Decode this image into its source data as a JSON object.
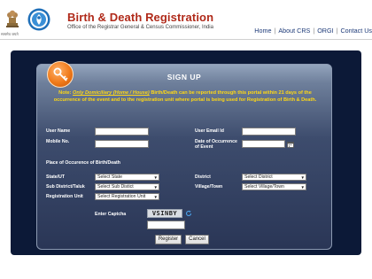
{
  "header": {
    "emblem_caption": "सत्यमेव जयते",
    "title": "Birth & Death Registration",
    "subtitle": "Office of the Registrar General & Census Commissioner, India",
    "nav": [
      "Home",
      "About CRS",
      "ORGI",
      "Contact Us"
    ]
  },
  "form": {
    "title": "SIGN UP",
    "note_prefix": "Note: ",
    "note_emph": "Only Domiciliary (Home / House)",
    "note_rest": " Birth/Death can be reported through this portal within 21 days of the occurrence of the event and to the registration unit where portal is being used for Registration of Birth & Death.",
    "labels": {
      "user_name": "User Name",
      "user_email": "User Email Id",
      "mobile_no": "Mobile No.",
      "date_of_occurrence_1": "Date of Occurrence",
      "date_of_occurrence_2": "of Event",
      "place_heading": "Place of Occurence of Birth/Death",
      "state_ut": "State/UT",
      "district": "District",
      "sub_district": "Sub District/Taluk",
      "village_town": "Village/Town",
      "registration_unit": "Registration Unit",
      "enter_captcha": "Enter Captcha"
    },
    "inputs": {
      "user_name": "",
      "user_email": "",
      "mobile_no": "",
      "date_of_occurrence": "",
      "captcha": ""
    },
    "selects": {
      "state": "Select State",
      "district": "Select District",
      "sub_district": "Select Sub Distict",
      "village": "Select Village/Town",
      "registration_unit": "Select Registration Unit"
    },
    "captcha_text": "VSINBY",
    "buttons": {
      "register": "Register",
      "cancel": "Cancel"
    }
  },
  "colors": {
    "title_red": "#b02a1a",
    "panel_navy": "#0c1937",
    "note_yellow": "#ffd814",
    "badge_orange": "#f07a1a"
  }
}
